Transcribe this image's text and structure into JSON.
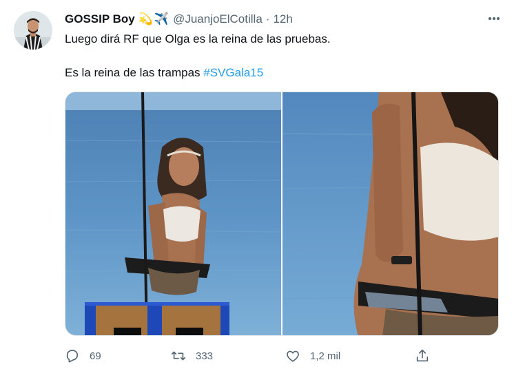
{
  "author": {
    "name": "GOSSIP Boy",
    "badges": [
      "💫",
      "✈️"
    ],
    "handle": "@JuanjoElCotilla",
    "separator": "·",
    "time": "12h"
  },
  "tweet": {
    "line1": "Luego dirá RF que Olga es la reina de las pruebas.",
    "line2_text": "Es la reina de las trampas ",
    "hashtag": "#SVGala15"
  },
  "media": {
    "images": [
      {
        "subject": "woman-on-platform-sea"
      },
      {
        "subject": "woman-closeup-sea"
      }
    ]
  },
  "actions": {
    "reply_count": "69",
    "retweet_count": "333",
    "like_count": "1,2 mil"
  },
  "colors": {
    "text": "#0f1419",
    "secondary": "#536471",
    "link": "#1d9bf0"
  }
}
